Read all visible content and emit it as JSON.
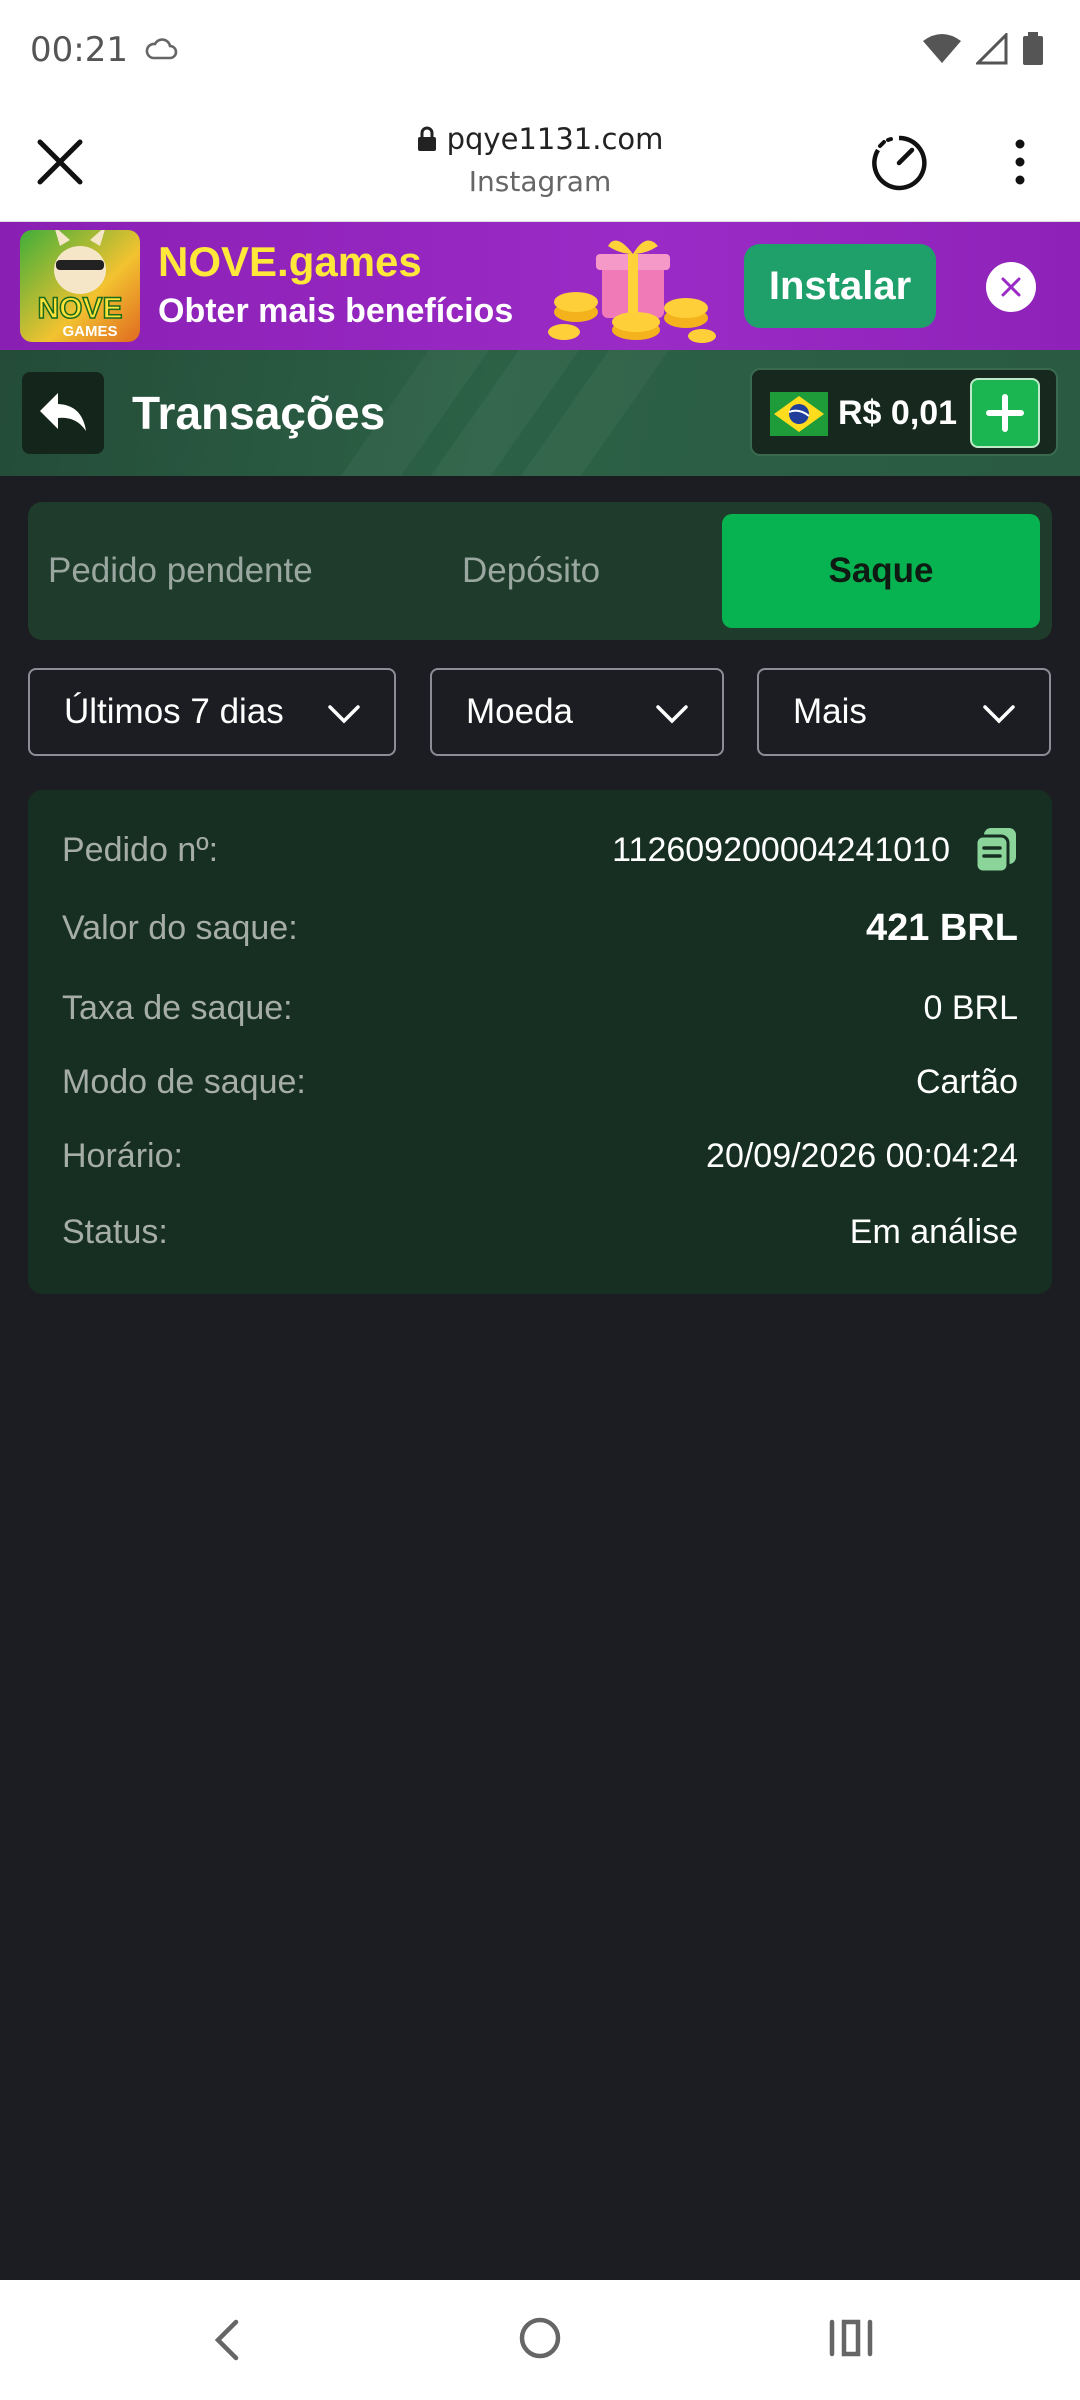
{
  "status_bar": {
    "time": "00:21",
    "icons": [
      "cloud-icon",
      "wifi-icon",
      "signal-icon",
      "battery-icon"
    ]
  },
  "browser": {
    "url": "pqye1131.com",
    "source": "Instagram",
    "icons": [
      "close-icon",
      "lock-icon",
      "speed-icon",
      "more-vertical-icon"
    ]
  },
  "banner": {
    "title": "NOVE.games",
    "subtitle": "Obter mais benefícios",
    "install_label": "Instalar",
    "logo_text": "NOVE GAMES",
    "colors": {
      "background": "#9b2bc6",
      "title": "#ffe83a",
      "button": "#1fa06b"
    }
  },
  "header": {
    "title": "Transações",
    "balance": "R$ 0,01",
    "icons": [
      "back-arrow-icon",
      "brazil-flag-icon",
      "plus-icon"
    ]
  },
  "tabs": [
    {
      "label": "Pedido pendente",
      "active": false
    },
    {
      "label": "Depósito",
      "active": false
    },
    {
      "label": "Saque",
      "active": true
    }
  ],
  "filters": [
    {
      "label": "Últimos 7 dias"
    },
    {
      "label": "Moeda"
    },
    {
      "label": "Mais"
    }
  ],
  "transaction": {
    "rows": [
      {
        "label": "Pedido nº:",
        "value": "112609200004241010"
      },
      {
        "label": "Valor do saque:",
        "value": "421 BRL"
      },
      {
        "label": "Taxa de saque:",
        "value": "0 BRL"
      },
      {
        "label": "Modo de saque:",
        "value": "Cartão"
      },
      {
        "label": "Horário:",
        "value": "20/09/2026 00:04:24"
      },
      {
        "label": "Status:",
        "value": "Em análise"
      }
    ]
  },
  "nav": {
    "icons": [
      "nav-back-icon",
      "nav-home-icon",
      "nav-recents-icon"
    ]
  },
  "colors": {
    "accent_green": "#07b350",
    "page_bg": "#1c1d22",
    "card_bg": "#162f22"
  }
}
